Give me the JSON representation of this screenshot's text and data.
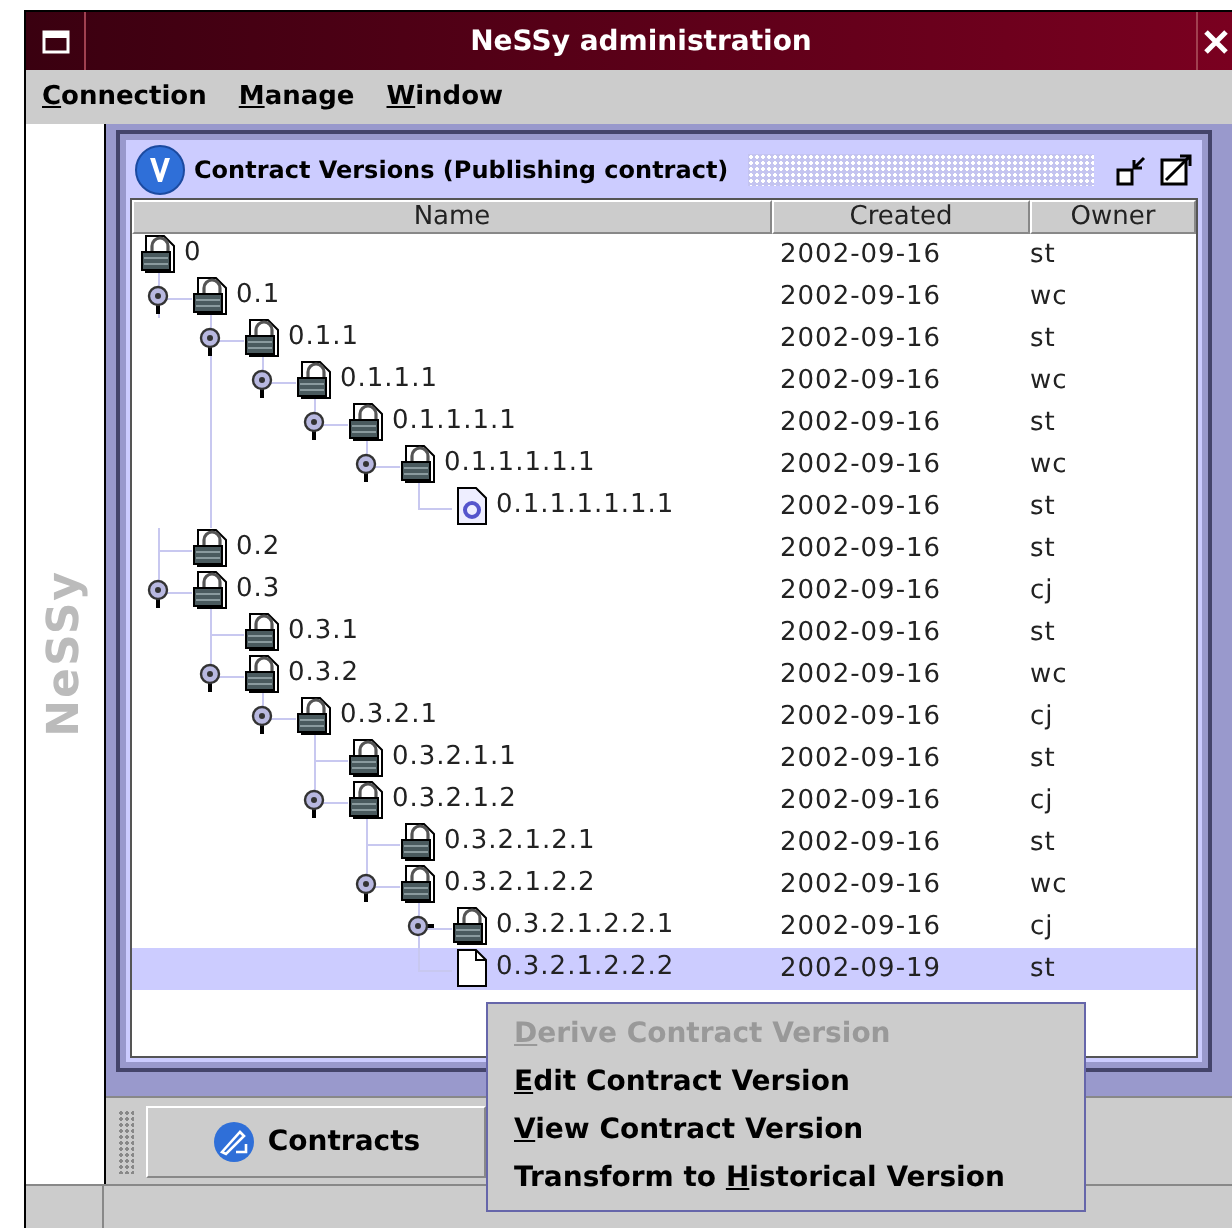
{
  "window": {
    "title": "NeSSy administration"
  },
  "menu_bar": [
    {
      "key": "C",
      "post": "onnection"
    },
    {
      "key": "M",
      "post": "anage"
    },
    {
      "key": "W",
      "post": "indow"
    }
  ],
  "side_label": "NeSSy",
  "internal_frame": {
    "title": "Contract Versions (Publishing contract)"
  },
  "table": {
    "columns": [
      "Name",
      "Created",
      "Owner"
    ],
    "rows": [
      {
        "name": "0",
        "created": "2002-09-16",
        "owner": "st",
        "kind": "locked",
        "selected": false,
        "children": [
          {
            "name": "0.1",
            "created": "2002-09-16",
            "owner": "wc",
            "kind": "locked",
            "selected": false,
            "expanded": true,
            "children": [
              {
                "name": "0.1.1",
                "created": "2002-09-16",
                "owner": "st",
                "kind": "locked",
                "selected": false,
                "expanded": true,
                "children": [
                  {
                    "name": "0.1.1.1",
                    "created": "2002-09-16",
                    "owner": "wc",
                    "kind": "locked",
                    "selected": false,
                    "expanded": true,
                    "children": [
                      {
                        "name": "0.1.1.1.1",
                        "created": "2002-09-16",
                        "owner": "st",
                        "kind": "locked",
                        "selected": false,
                        "expanded": true,
                        "children": [
                          {
                            "name": "0.1.1.1.1.1",
                            "created": "2002-09-16",
                            "owner": "wc",
                            "kind": "locked",
                            "selected": false,
                            "expanded": true,
                            "children": [
                              {
                                "name": "0.1.1.1.1.1.1",
                                "created": "2002-09-16",
                                "owner": "st",
                                "kind": "pending",
                                "selected": false
                              }
                            ]
                          }
                        ]
                      }
                    ]
                  }
                ]
              }
            ]
          },
          {
            "name": "0.2",
            "created": "2002-09-16",
            "owner": "st",
            "kind": "locked",
            "selected": false
          },
          {
            "name": "0.3",
            "created": "2002-09-16",
            "owner": "cj",
            "kind": "locked",
            "selected": false,
            "expanded": true,
            "children": [
              {
                "name": "0.3.1",
                "created": "2002-09-16",
                "owner": "st",
                "kind": "locked",
                "selected": false
              },
              {
                "name": "0.3.2",
                "created": "2002-09-16",
                "owner": "wc",
                "kind": "locked",
                "selected": false,
                "expanded": true,
                "children": [
                  {
                    "name": "0.3.2.1",
                    "created": "2002-09-16",
                    "owner": "cj",
                    "kind": "locked",
                    "selected": false,
                    "expanded": true,
                    "children": [
                      {
                        "name": "0.3.2.1.1",
                        "created": "2002-09-16",
                        "owner": "st",
                        "kind": "locked",
                        "selected": false
                      },
                      {
                        "name": "0.3.2.1.2",
                        "created": "2002-09-16",
                        "owner": "cj",
                        "kind": "locked",
                        "selected": false,
                        "expanded": true,
                        "children": [
                          {
                            "name": "0.3.2.1.2.1",
                            "created": "2002-09-16",
                            "owner": "st",
                            "kind": "locked",
                            "selected": false
                          },
                          {
                            "name": "0.3.2.1.2.2",
                            "created": "2002-09-16",
                            "owner": "wc",
                            "kind": "locked",
                            "selected": false,
                            "expanded": true,
                            "children": [
                              {
                                "name": "0.3.2.1.2.2.1",
                                "created": "2002-09-16",
                                "owner": "cj",
                                "kind": "locked",
                                "selected": false,
                                "expanded": false
                              },
                              {
                                "name": "0.3.2.1.2.2.2",
                                "created": "2002-09-19",
                                "owner": "st",
                                "kind": "blank",
                                "selected": true
                              }
                            ]
                          }
                        ]
                      }
                    ]
                  }
                ]
              }
            ]
          }
        ]
      }
    ]
  },
  "context_menu": [
    {
      "key": "D",
      "post": "erive Contract Version",
      "disabled": true
    },
    {
      "key": "E",
      "post": "dit Contract Version",
      "disabled": false
    },
    {
      "key": "V",
      "post": "iew Contract Version",
      "disabled": false
    },
    {
      "pre": "Transform to ",
      "key": "H",
      "post": "istorical Version",
      "disabled": false
    }
  ],
  "taskbar": [
    {
      "label": "Contracts"
    }
  ]
}
